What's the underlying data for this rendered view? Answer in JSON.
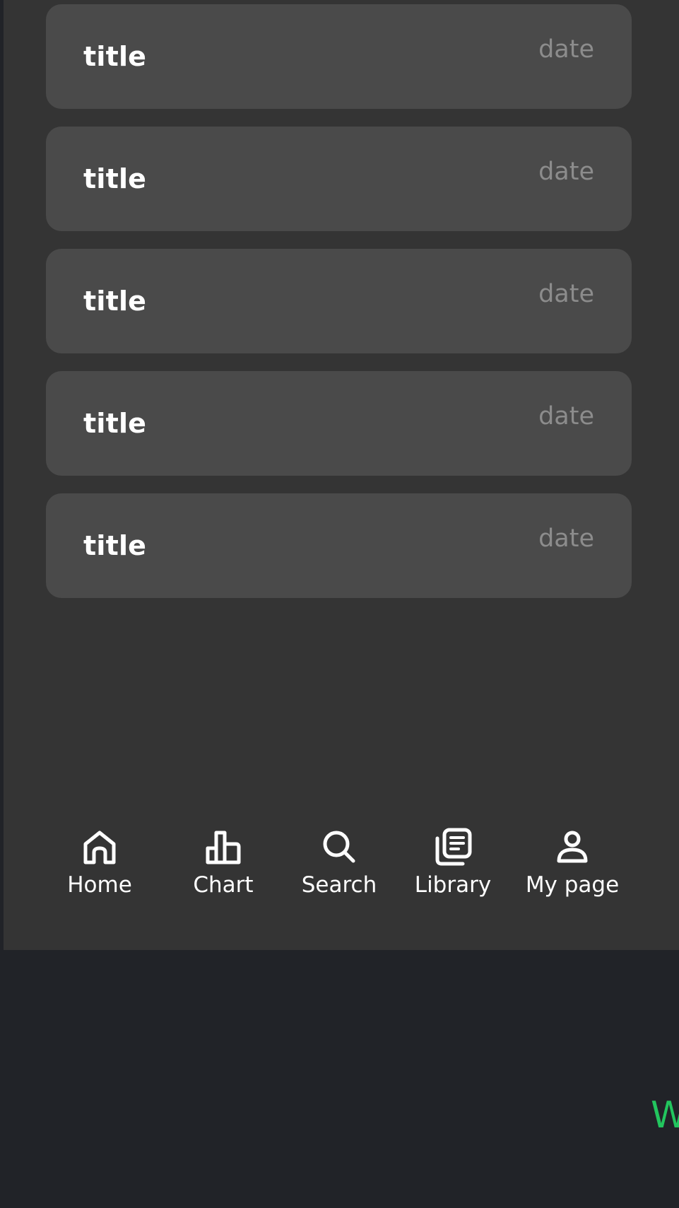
{
  "list": {
    "items": [
      {
        "title": "title",
        "date": "date"
      },
      {
        "title": "title",
        "date": "date"
      },
      {
        "title": "title",
        "date": "date"
      },
      {
        "title": "title",
        "date": "date"
      },
      {
        "title": "title",
        "date": "date"
      }
    ]
  },
  "tabbar": {
    "tabs": [
      {
        "label": "Home",
        "icon": "home-icon"
      },
      {
        "label": "Chart",
        "icon": "chart-icon"
      },
      {
        "label": "Search",
        "icon": "search-icon"
      },
      {
        "label": "Library",
        "icon": "library-icon"
      },
      {
        "label": "My page",
        "icon": "user-icon"
      }
    ]
  },
  "corner": {
    "text": "W"
  },
  "colors": {
    "outer_background": "#212328",
    "panel_background": "#343434",
    "card_background": "#4a4a4a",
    "date_text": "#8c8c8c",
    "accent_green": "#22c55e"
  }
}
